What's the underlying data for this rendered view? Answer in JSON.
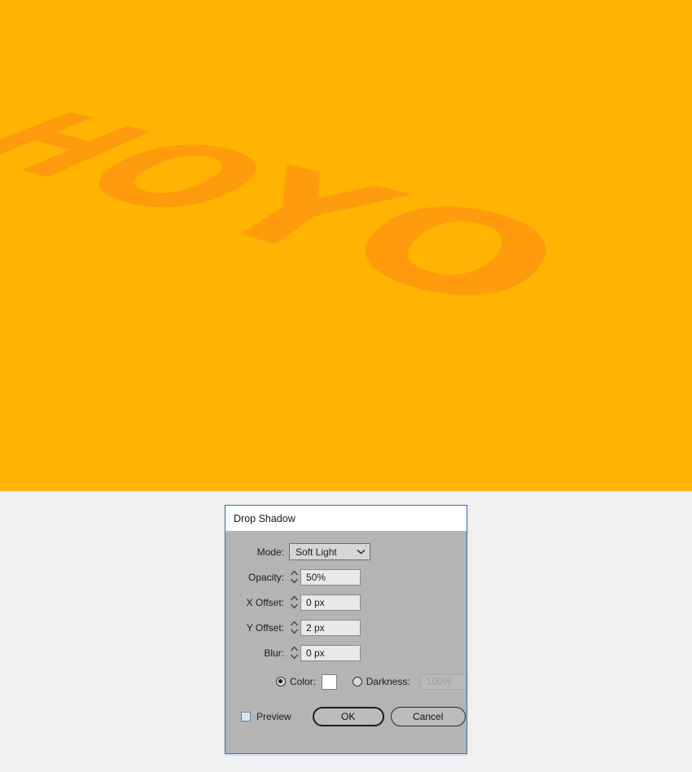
{
  "canvas": {
    "background_color": "#FFB401",
    "artwork_text": "HOYO",
    "artwork_color": "#FF9B0C"
  },
  "dialog": {
    "title": "Drop Shadow",
    "border_color": "#3573B8",
    "fields": {
      "mode": {
        "label": "Mode:",
        "value": "Soft Light"
      },
      "opacity": {
        "label": "Opacity:",
        "value": "50%"
      },
      "x_offset": {
        "label": "X Offset:",
        "value": "0 px"
      },
      "y_offset": {
        "label": "Y Offset:",
        "value": "2 px"
      },
      "blur": {
        "label": "Blur:",
        "value": "0 px"
      }
    },
    "shadow_source": {
      "color_label": "Color:",
      "color_value": "#FFFFFF",
      "darkness_label": "Darkness:",
      "darkness_value": "100%"
    },
    "preview_label": "Preview",
    "ok_label": "OK",
    "cancel_label": "Cancel"
  }
}
